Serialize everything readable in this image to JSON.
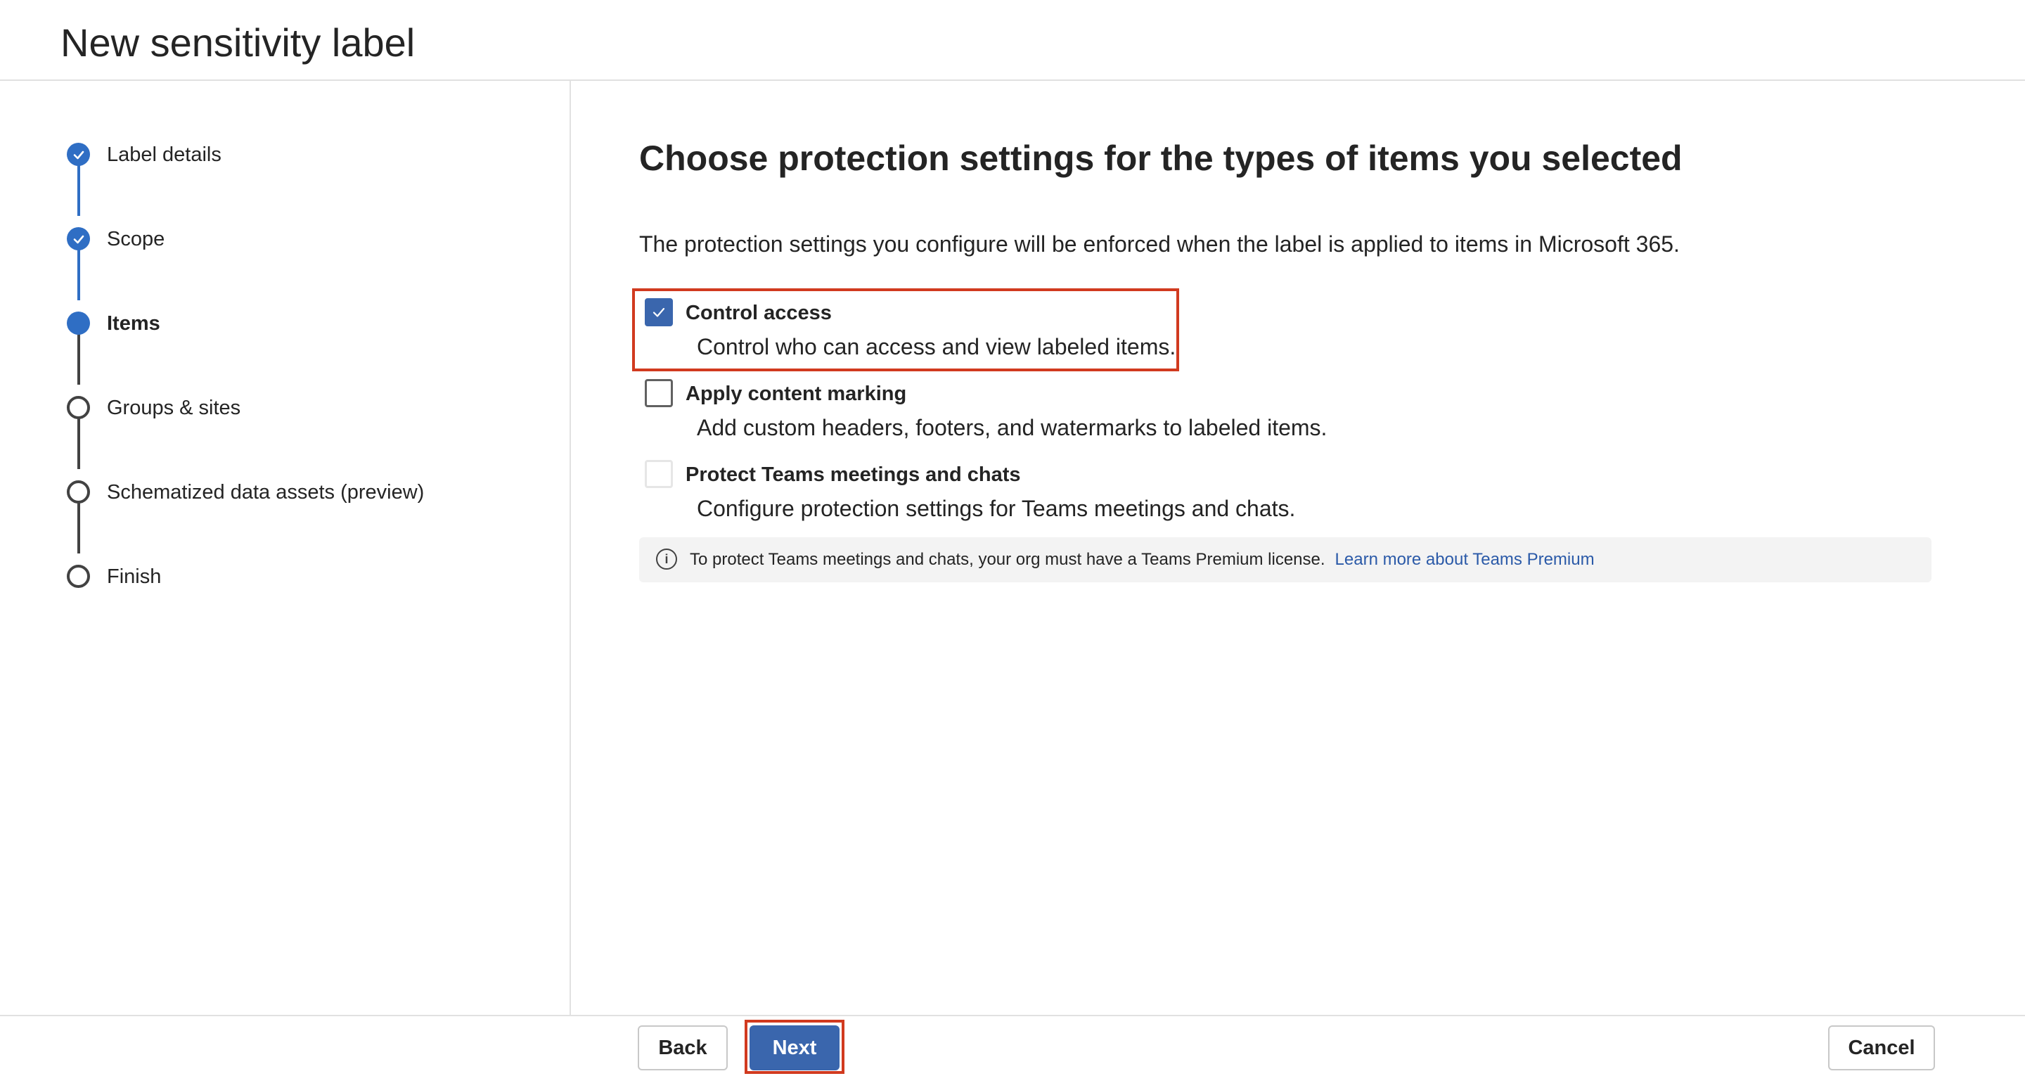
{
  "header": {
    "title": "New sensitivity label"
  },
  "steps": [
    {
      "label": "Label details",
      "state": "done"
    },
    {
      "label": "Scope",
      "state": "done"
    },
    {
      "label": "Items",
      "state": "current"
    },
    {
      "label": "Groups & sites",
      "state": "todo"
    },
    {
      "label": "Schematized data assets (preview)",
      "state": "todo"
    },
    {
      "label": "Finish",
      "state": "todo"
    }
  ],
  "main": {
    "title": "Choose protection settings for the types of items you selected",
    "description": "The protection settings you configure will be enforced when the label is applied to items in Microsoft 365.",
    "options": [
      {
        "title": "Control access",
        "description": "Control who can access and view labeled items.",
        "checked": true,
        "disabled": false
      },
      {
        "title": "Apply content marking",
        "description": "Add custom headers, footers, and watermarks to labeled items.",
        "checked": false,
        "disabled": false
      },
      {
        "title": "Protect Teams meetings and chats",
        "description": "Configure protection settings for Teams meetings and chats.",
        "checked": false,
        "disabled": true
      }
    ],
    "info": {
      "icon": "info-icon",
      "text": "To protect Teams meetings and chats, your org must have a Teams Premium license.",
      "link": "Learn more about Teams Premium"
    }
  },
  "footer": {
    "back_label": "Back",
    "next_label": "Next",
    "cancel_label": "Cancel"
  },
  "colors": {
    "accent": "#2f6ec4",
    "primary_button": "#3a66ad",
    "highlight": "#d13a1f",
    "link": "#2b5aa8"
  }
}
